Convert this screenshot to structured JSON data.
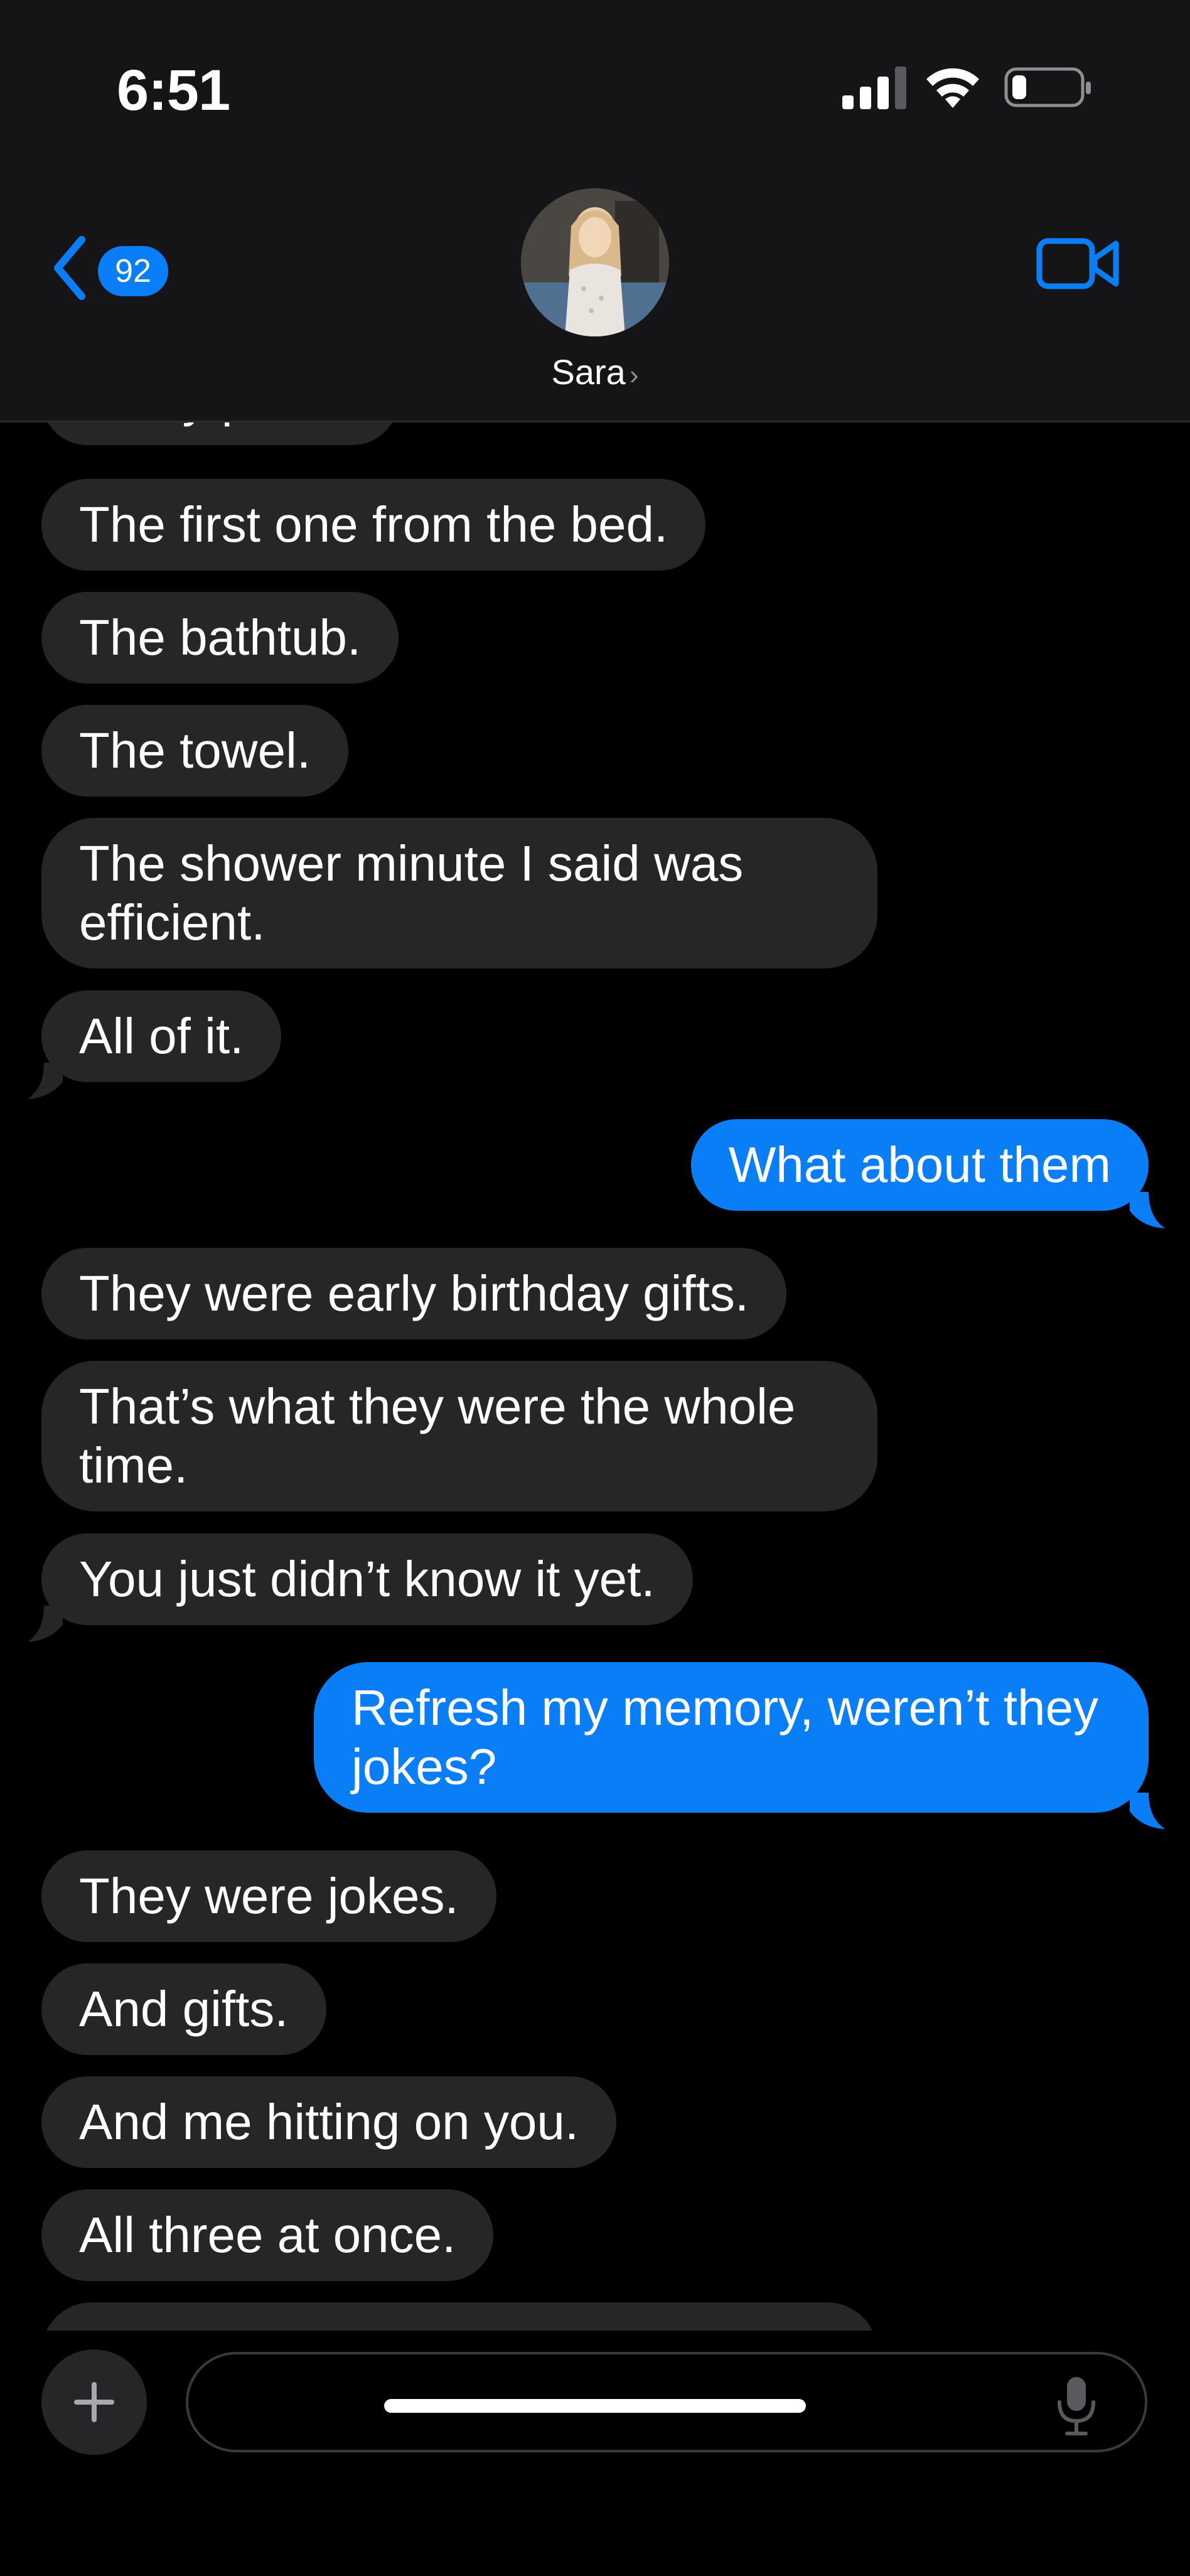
{
  "status_bar": {
    "time": "6:51",
    "battery_level_fraction": 0.15
  },
  "header": {
    "back_badge_count": "92",
    "contact_name": "Sara",
    "contact_chevron": "›",
    "icons": {
      "back": "chevron-left-icon",
      "video": "video-camera-icon"
    }
  },
  "messages": [
    {
      "direction": "in",
      "text": "Every photo."
    },
    {
      "direction": "in",
      "text": "The first one from the bed."
    },
    {
      "direction": "in",
      "text": "The bathtub."
    },
    {
      "direction": "in",
      "text": "The towel."
    },
    {
      "direction": "in",
      "text": "The shower minute I said was efficient."
    },
    {
      "direction": "in",
      "text": "All of it."
    },
    {
      "direction": "out",
      "text": "What about them"
    },
    {
      "direction": "in",
      "text": "They were early birthday gifts."
    },
    {
      "direction": "in",
      "text": "That’s what they were the whole time."
    },
    {
      "direction": "in",
      "text": "You just didn’t know it yet."
    },
    {
      "direction": "out",
      "text": "Refresh my memory, weren’t they jokes?"
    },
    {
      "direction": "in",
      "text": "They were jokes."
    },
    {
      "direction": "in",
      "text": "And gifts."
    },
    {
      "direction": "in",
      "text": "And me hitting on you."
    },
    {
      "direction": "in",
      "text": "All three at once."
    }
  ],
  "compose": {
    "placeholder": "",
    "icons": {
      "plus": "plus-icon",
      "mic": "microphone-icon"
    }
  },
  "colors": {
    "incoming_bubble": "#262629",
    "outgoing_bubble": "#0a7ef7",
    "background": "#000000",
    "header": "#151517"
  }
}
